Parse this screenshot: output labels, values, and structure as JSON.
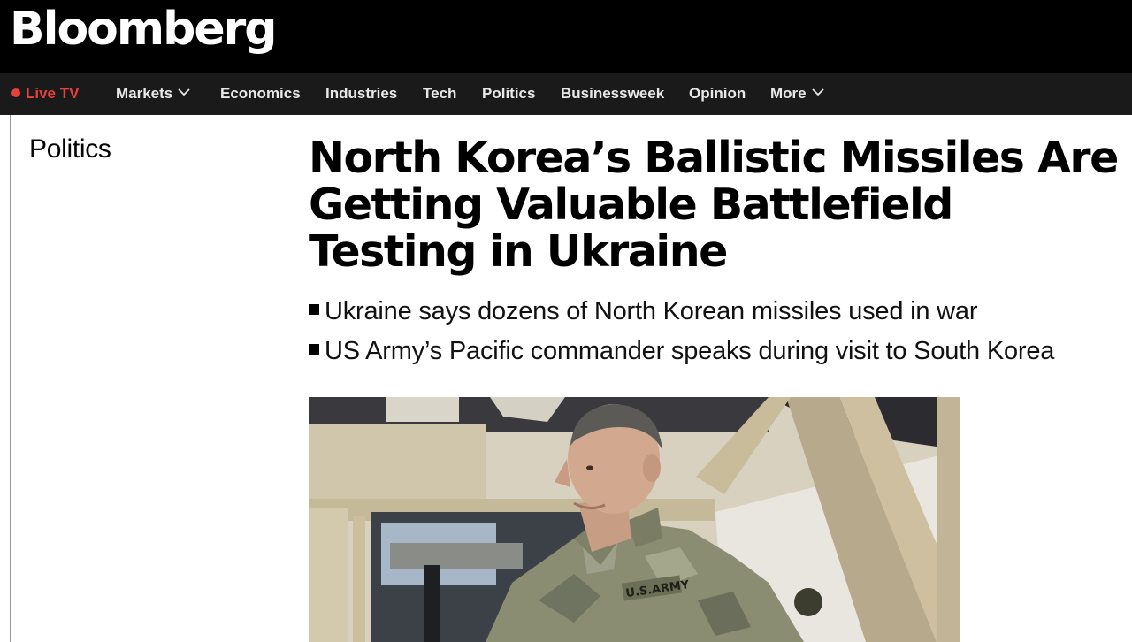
{
  "brand": {
    "logo_text": "Bloomberg"
  },
  "nav": {
    "live_tv": "Live TV",
    "items": [
      "Markets",
      "Economics",
      "Industries",
      "Tech",
      "Politics",
      "Businessweek",
      "Opinion",
      "More"
    ]
  },
  "article": {
    "section": "Politics",
    "headline": "North Korea’s Ballistic Missiles Are Getting Valuable Battlefield Testing in Ukraine",
    "bullets": [
      "Ukraine says dozens of North Korean missiles used in war",
      "US Army’s Pacific commander speaks during visit to South Korea"
    ],
    "photo_patch_text": "U.S.ARMY"
  },
  "colors": {
    "live": "#e8413b",
    "header_bg": "#000000",
    "nav_bg": "#1a1a1a"
  }
}
